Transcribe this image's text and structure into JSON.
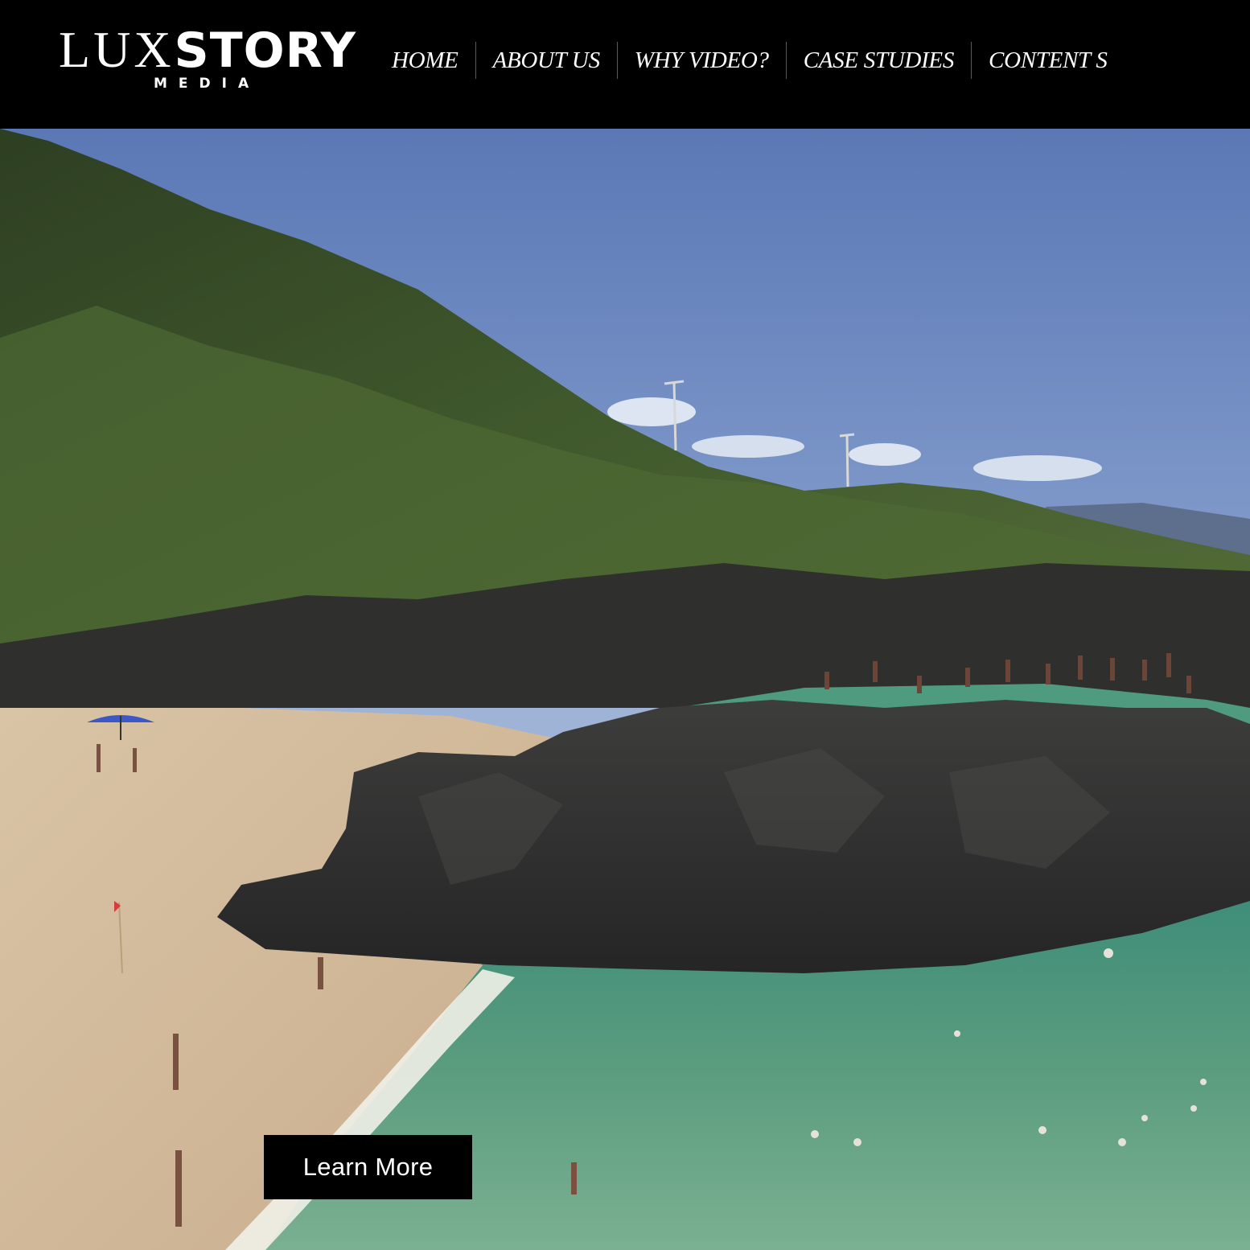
{
  "brand": {
    "name_part1": "LUX",
    "name_part2": "STORY",
    "tagline": "MEDIA"
  },
  "nav": {
    "items": [
      {
        "label": "HOME"
      },
      {
        "label": "ABOUT US"
      },
      {
        "label": "WHY VIDEO?"
      },
      {
        "label": "CASE STUDIES"
      },
      {
        "label": "CONTENT S"
      }
    ]
  },
  "hero": {
    "scene_icon": "video-background-icon",
    "cta_label": "Learn More"
  },
  "colors": {
    "header_bg": "#000000",
    "nav_text": "#ffffff",
    "cta_bg": "#000000",
    "cta_text": "#ffffff"
  }
}
